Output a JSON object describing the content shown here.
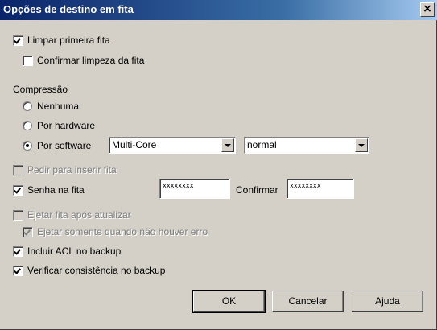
{
  "dialog": {
    "title": "Opções de destino em fita",
    "close_symbol": "×"
  },
  "options": {
    "limpar_primeira_fita": {
      "label": "Limpar primeira fita",
      "checked": true,
      "enabled": true
    },
    "confirmar_limpeza": {
      "label": "Confirmar limpeza da fita",
      "checked": false,
      "enabled": true
    }
  },
  "compressao": {
    "label": "Compressão",
    "none": {
      "label": "Nenhuma",
      "selected": false
    },
    "hardware": {
      "label": "Por hardware",
      "selected": false
    },
    "software": {
      "label": "Por software",
      "selected": true
    },
    "method_select": {
      "value": "Multi-Core"
    },
    "level_select": {
      "value": "normal"
    }
  },
  "pedir_inserir": {
    "label": "Pedir para inserir fita",
    "checked": false,
    "enabled": false
  },
  "senha": {
    "label": "Senha na fita",
    "checked": true,
    "password_value": "xxxxxxxx",
    "confirm_label": "Confirmar",
    "confirm_value": "xxxxxxxx"
  },
  "ejetar": {
    "label": "Ejetar fita após atualizar",
    "checked": false,
    "enabled": false
  },
  "ejetar_sem_erro": {
    "label": "Ejetar somente quando não houver erro",
    "checked": true,
    "enabled": false
  },
  "incluir_acl": {
    "label": "Incluir ACL no backup",
    "checked": true,
    "enabled": true
  },
  "verificar": {
    "label": "Verificar consistência no backup",
    "checked": true,
    "enabled": true
  },
  "buttons": {
    "ok": "OK",
    "cancel": "Cancelar",
    "help": "Ajuda"
  }
}
